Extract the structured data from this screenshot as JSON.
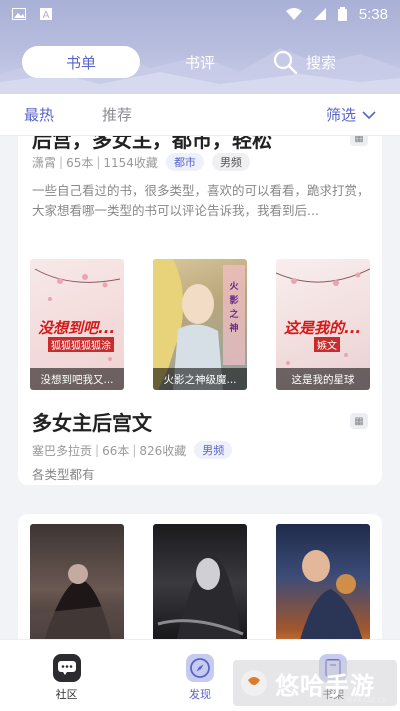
{
  "status_bar": {
    "time": "5:38"
  },
  "top_tabs": [
    {
      "label": "书单",
      "active": true
    },
    {
      "label": "书评",
      "active": false
    }
  ],
  "search": {
    "label": "搜索"
  },
  "filter_bar": {
    "tabs": [
      {
        "label": "最热",
        "active": true
      },
      {
        "label": "推荐",
        "active": false
      }
    ],
    "filter_label": "筛选"
  },
  "booklists": [
    {
      "title": "后宫，多女主，都市，轻松",
      "author": "潇霄",
      "count": "65本",
      "favorites": "1154收藏",
      "tags": [
        "都市",
        "男频"
      ],
      "description": "一些自己看过的书，很多类型，喜欢的可以看看，跪求打赏，大家想看哪一类型的书可以评论告诉我，我看到后..."
    },
    {
      "title": "多女主后宫文",
      "author": "塞巴多拉贡",
      "count": "66本",
      "favorites": "826收藏",
      "tags": [
        "男频"
      ],
      "description": "各类型都有",
      "covers": [
        {
          "caption": "没想到吧我又...",
          "cover_text": "没想到吧...",
          "cover_sub": "狐狐狐狐狐涂"
        },
        {
          "caption": "火影之神级魔..."
        },
        {
          "caption": "这是我的星球",
          "cover_text": "这是我的...",
          "cover_sub": "嫉文"
        }
      ]
    },
    {
      "covers": [
        {
          "caption": ""
        },
        {
          "caption": ""
        },
        {
          "caption": ""
        }
      ]
    }
  ],
  "bottom_nav": [
    {
      "label": "社区",
      "icon": "chat-icon"
    },
    {
      "label": "发现",
      "icon": "compass-icon"
    },
    {
      "label": "书架",
      "icon": "shelf-icon"
    }
  ],
  "watermark": {
    "text": "悠哈手游",
    "url": "wxxxzz.cn"
  },
  "colors": {
    "accent": "#5965c9",
    "header": "#b4bade"
  }
}
